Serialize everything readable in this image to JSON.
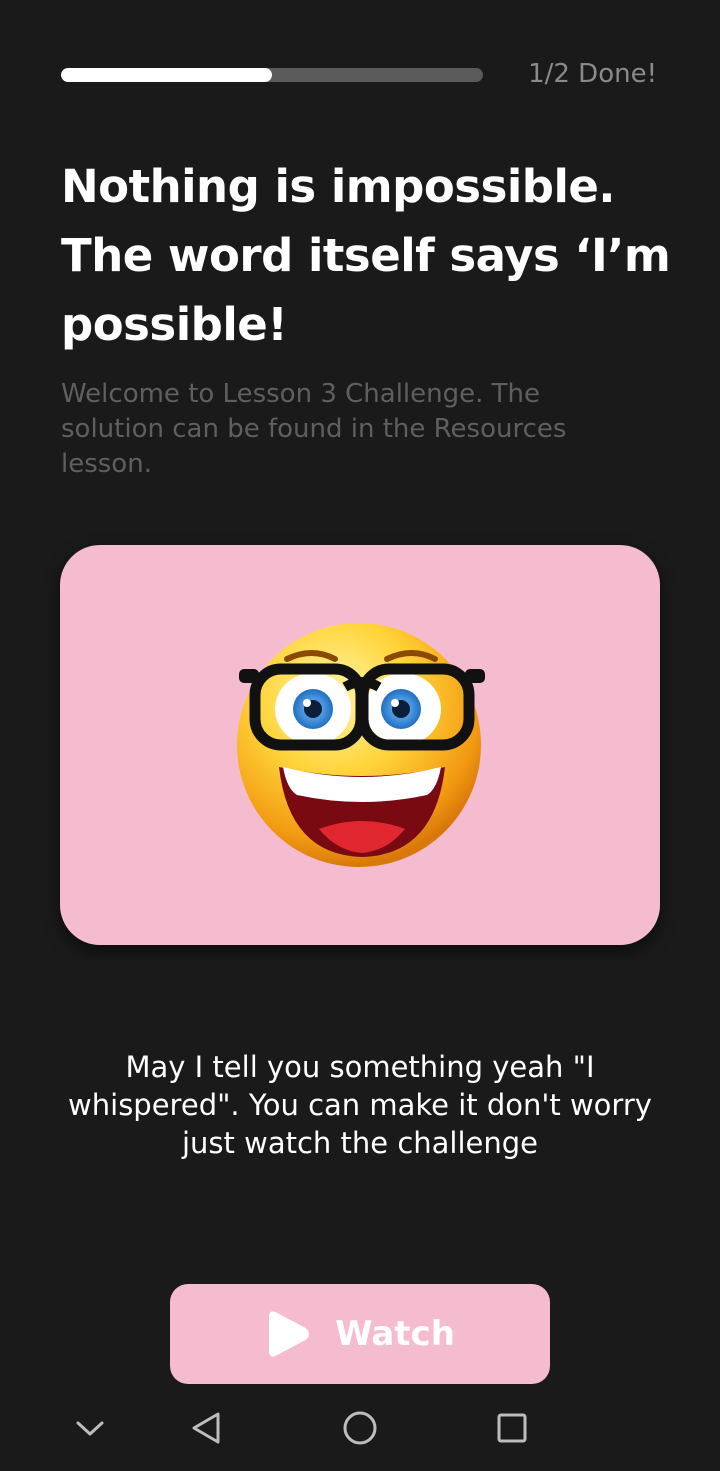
{
  "progress": {
    "fraction": 0.5,
    "label": "1/2 Done!"
  },
  "lesson": {
    "headline": "Nothing is impossible. The word itself says ‘I’m possible!",
    "subtitle": "Welcome to Lesson 3 Challenge. The solution can be found in the Resources lesson."
  },
  "media": {
    "icon": "nerd-emoji-icon",
    "background_color": "#f5bccf"
  },
  "message": "May I tell you something yeah \"I whispered\". You can make it don't worry just watch the challenge",
  "watch_button": {
    "label": "Watch",
    "icon": "play-icon",
    "color": "#f5bccf"
  },
  "nav": {
    "items": [
      "chevron-down-icon",
      "back-triangle-icon",
      "home-circle-icon",
      "recents-square-icon"
    ]
  },
  "colors": {
    "background": "#1b1a1b",
    "accent": "#f5bccf",
    "progress_track": "#5a5a5a"
  }
}
